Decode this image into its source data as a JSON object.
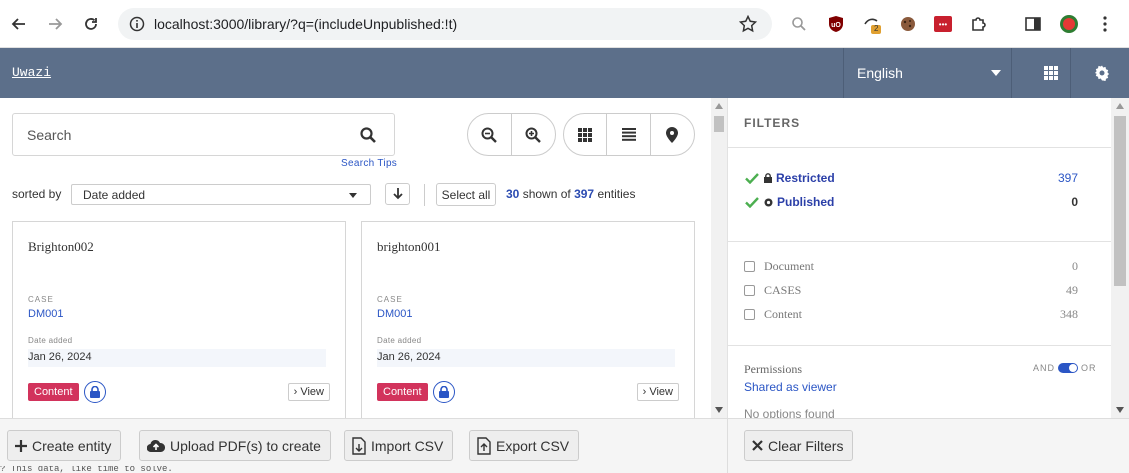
{
  "browser": {
    "url": "localhost:3000/library/?q=(includeUnpublished:!t)",
    "extension_badge": "2"
  },
  "header": {
    "brand": "Uwazi",
    "language": "English"
  },
  "search": {
    "placeholder": "Search",
    "tips": "Search Tips"
  },
  "sort": {
    "label": "sorted by",
    "value": "Date added",
    "select_all": "Select all",
    "shown": "30",
    "shown_of": "shown of",
    "total": "397",
    "entities": "entities"
  },
  "cards": [
    {
      "title": "Brighton002",
      "meta_label": "CASE",
      "meta_value": "DM001",
      "date_label": "Date added",
      "date_value": "Jan 26, 2024",
      "tag": "Content",
      "view": "View"
    },
    {
      "title": "brighton001",
      "meta_label": "CASE",
      "meta_value": "DM001",
      "date_label": "Date added",
      "date_value": "Jan 26, 2024",
      "tag": "Content",
      "view": "View"
    }
  ],
  "filters": {
    "title": "FILTERS",
    "permissions": [
      {
        "label": "Restricted",
        "count": "397"
      },
      {
        "label": "Published",
        "count": "0"
      }
    ],
    "types": [
      {
        "label": "Document",
        "count": "0"
      },
      {
        "label": "CASES",
        "count": "49"
      },
      {
        "label": "Content",
        "count": "348"
      }
    ],
    "permissions_title": "Permissions",
    "and_label": "AND",
    "or_label": "OR",
    "shared_as_viewer": "Shared as viewer",
    "no_options": "No options found"
  },
  "bottom": {
    "create_entity": "Create entity",
    "upload_pdf": "Upload PDF(s) to create",
    "import_csv": "Import CSV",
    "export_csv": "Export CSV",
    "clear_filters": "Clear Filters"
  },
  "terminal": {
    "text": "? This data, like time to solve."
  },
  "colors": {
    "header_bg": "#5c6f8a",
    "accent": "#2b56c5",
    "tag": "#d2335c",
    "check": "#4caf50"
  }
}
